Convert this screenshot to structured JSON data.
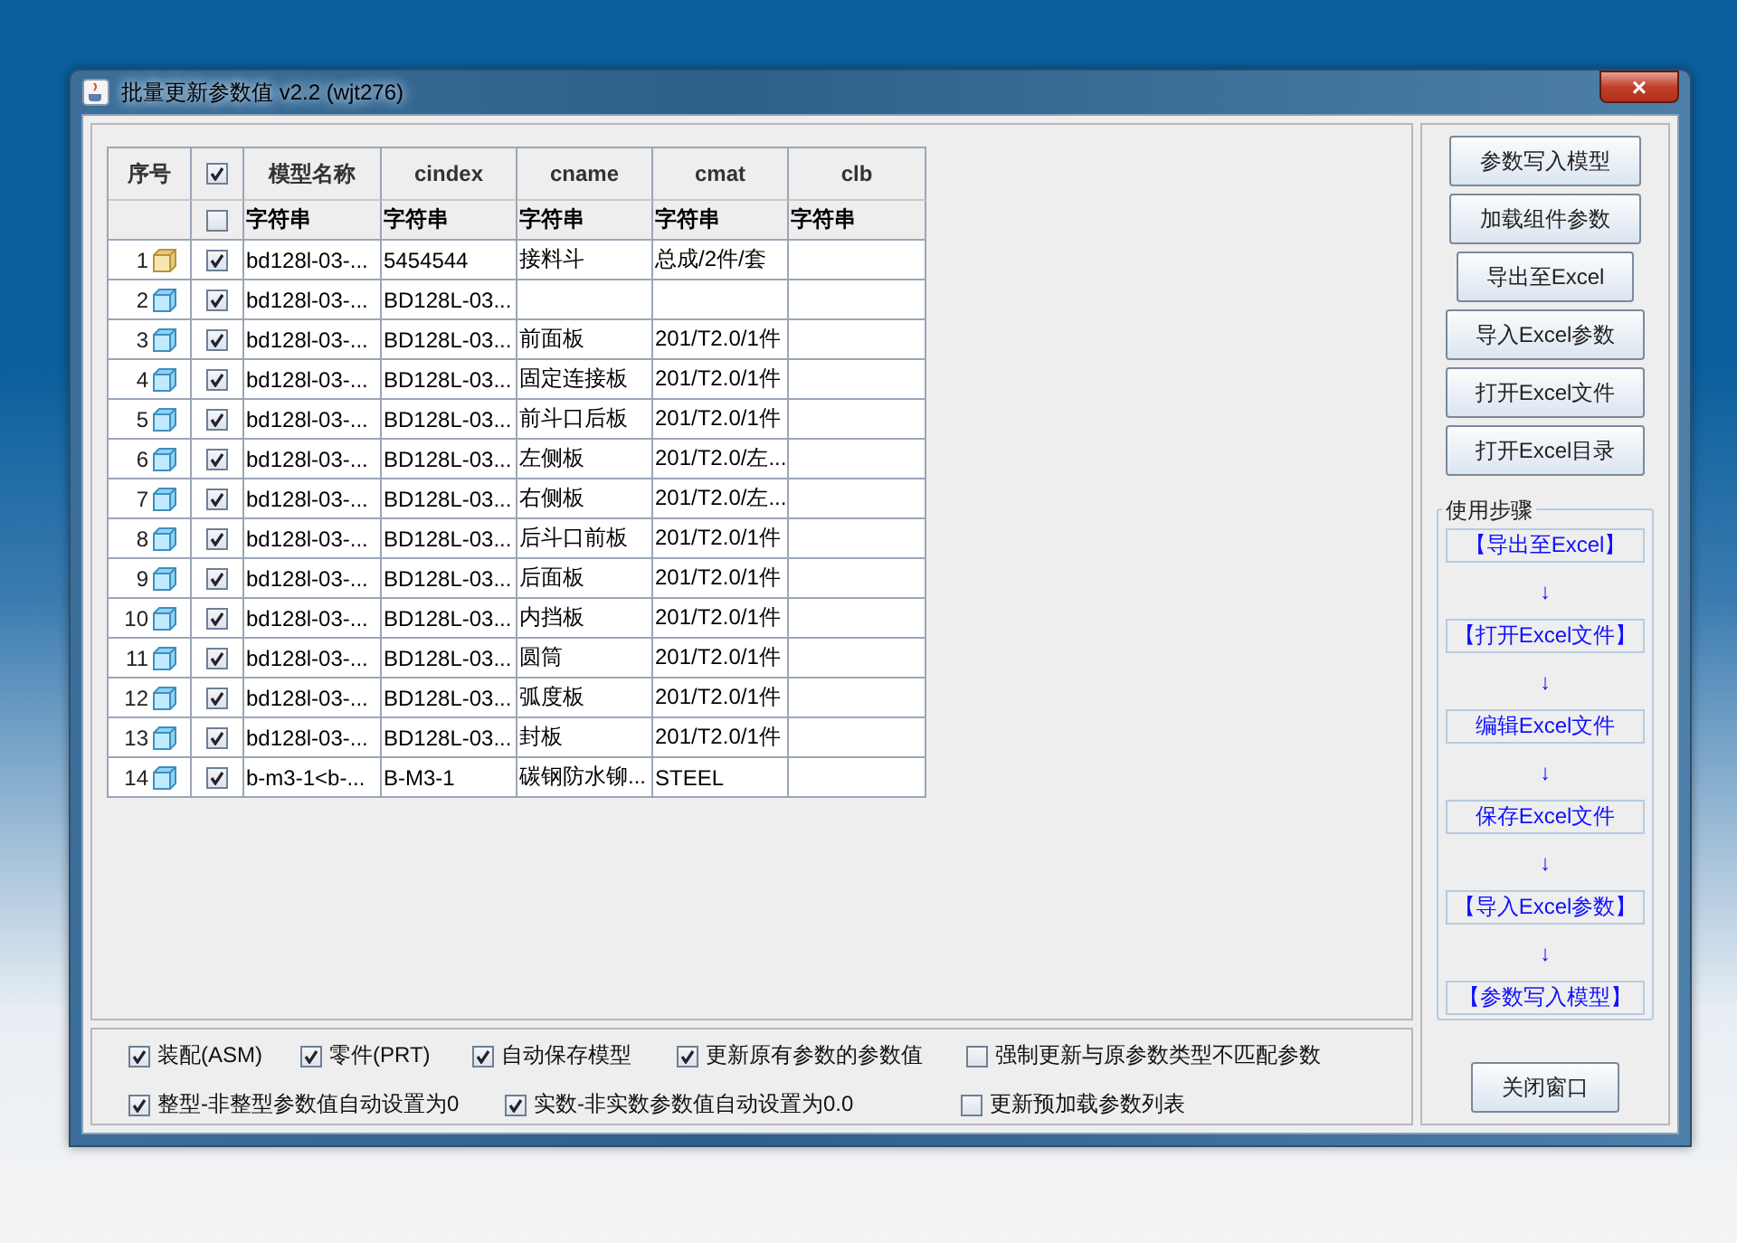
{
  "window": {
    "title": "批量更新参数值 v2.2 (wjt276)",
    "close": "×"
  },
  "table": {
    "columns": [
      "序号",
      "模型名称",
      "cindex",
      "cname",
      "cmat",
      "clb"
    ],
    "header_checked": true,
    "type_row": {
      "checked": false,
      "types": [
        "字符串",
        "字符串",
        "字符串",
        "字符串",
        "字符串"
      ]
    },
    "rows": [
      {
        "index": "1",
        "kind": "asm",
        "checked": true,
        "model": "bd128l-03-...",
        "cindex": "5454544",
        "cname": "接料斗",
        "cmat": "总成/2件/套"
      },
      {
        "index": "2",
        "kind": "prt",
        "checked": true,
        "model": "bd128l-03-...",
        "cindex": "BD128L-03..."
      },
      {
        "index": "3",
        "kind": "prt",
        "checked": true,
        "model": "bd128l-03-...",
        "cindex": "BD128L-03...",
        "cname": "前面板",
        "cmat": "201/T2.0/1件"
      },
      {
        "index": "4",
        "kind": "prt",
        "checked": true,
        "model": "bd128l-03-...",
        "cindex": "BD128L-03...",
        "cname": "固定连接板",
        "cmat": "201/T2.0/1件"
      },
      {
        "index": "5",
        "kind": "prt",
        "checked": true,
        "model": "bd128l-03-...",
        "cindex": "BD128L-03...",
        "cname": "前斗口后板",
        "cmat": "201/T2.0/1件"
      },
      {
        "index": "6",
        "kind": "prt",
        "checked": true,
        "model": "bd128l-03-...",
        "cindex": "BD128L-03...",
        "cname": "左侧板",
        "cmat": "201/T2.0/左..."
      },
      {
        "index": "7",
        "kind": "prt",
        "checked": true,
        "model": "bd128l-03-...",
        "cindex": "BD128L-03...",
        "cname": "右侧板",
        "cmat": "201/T2.0/左..."
      },
      {
        "index": "8",
        "kind": "prt",
        "checked": true,
        "model": "bd128l-03-...",
        "cindex": "BD128L-03...",
        "cname": "后斗口前板",
        "cmat": "201/T2.0/1件"
      },
      {
        "index": "9",
        "kind": "prt",
        "checked": true,
        "model": "bd128l-03-...",
        "cindex": "BD128L-03...",
        "cname": "后面板",
        "cmat": "201/T2.0/1件"
      },
      {
        "index": "10",
        "kind": "prt",
        "checked": true,
        "model": "bd128l-03-...",
        "cindex": "BD128L-03...",
        "cname": "内挡板",
        "cmat": "201/T2.0/1件"
      },
      {
        "index": "11",
        "kind": "prt",
        "checked": true,
        "model": "bd128l-03-...",
        "cindex": "BD128L-03...",
        "cname": "圆筒",
        "cmat": "201/T2.0/1件"
      },
      {
        "index": "12",
        "kind": "prt",
        "checked": true,
        "model": "bd128l-03-...",
        "cindex": "BD128L-03...",
        "cname": "弧度板",
        "cmat": "201/T2.0/1件"
      },
      {
        "index": "13",
        "kind": "prt",
        "checked": true,
        "model": "bd128l-03-...",
        "cindex": "BD128L-03...",
        "cname": "封板",
        "cmat": "201/T2.0/1件"
      },
      {
        "index": "14",
        "kind": "prt",
        "checked": true,
        "model": "b-m3-1<b-...",
        "cindex": "B-M3-1",
        "cname": "碳钢防水铆...",
        "cmat": "STEEL"
      }
    ]
  },
  "options": [
    [
      {
        "label": "装配(ASM)",
        "checked": true
      },
      {
        "label": "零件(PRT)",
        "checked": true
      },
      {
        "label": "自动保存模型",
        "checked": true
      },
      {
        "label": "更新原有参数的参数值",
        "checked": true
      },
      {
        "label": "强制更新与原参数类型不匹配参数",
        "checked": false
      }
    ],
    [
      {
        "label": "整型-非整型参数值自动设置为0",
        "checked": true
      },
      {
        "label": "实数-非实数参数值自动设置为0.0",
        "checked": true
      },
      {
        "label": "更新预加载参数列表",
        "checked": false
      }
    ]
  ],
  "buttons": [
    "参数写入模型",
    "加载组件参数",
    "导出至Excel",
    "导入Excel参数",
    "打开Excel文件",
    "打开Excel目录"
  ],
  "steps": {
    "title": "使用步骤",
    "items": [
      {
        "label": "【导出至Excel】",
        "arrow": "↓"
      },
      {
        "label": "【打开Excel文件】",
        "arrow": "↓"
      },
      {
        "label": "编辑Excel文件",
        "arrow": "↓"
      },
      {
        "label": "保存Excel文件",
        "arrow": "↓"
      },
      {
        "label": "【导入Excel参数】",
        "arrow": "↓"
      },
      {
        "label": "【参数写入模型】"
      }
    ]
  },
  "close_button": "关闭窗口"
}
